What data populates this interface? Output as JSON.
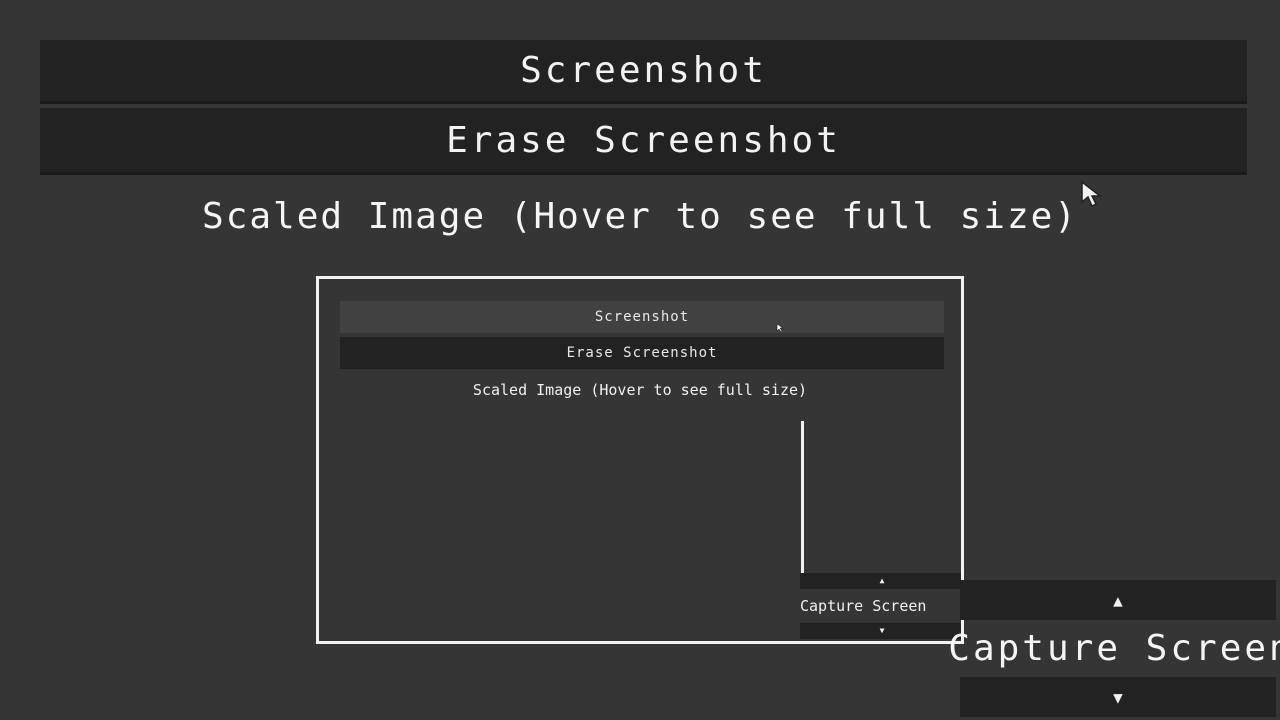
{
  "buttons": {
    "screenshot_label": "Screenshot",
    "erase_label": "Erase Screenshot"
  },
  "caption": "Scaled Image (Hover to see full size)",
  "preview": {
    "screenshot_label": "Screenshot",
    "erase_label": "Erase Screenshot",
    "caption": "Scaled Image (Hover to see full size)",
    "capture_label": "Capture Screen",
    "up_glyph": "▲",
    "down_glyph": "▼"
  },
  "spinner": {
    "value": "Capture Screen",
    "up_glyph": "▲",
    "down_glyph": "▼"
  },
  "icons": {
    "cursor": "mouse-pointer-icon"
  },
  "colors": {
    "background": "#353535",
    "button_bg": "#222222",
    "text": "#f2f2f2",
    "frame": "#f2f2f2"
  }
}
